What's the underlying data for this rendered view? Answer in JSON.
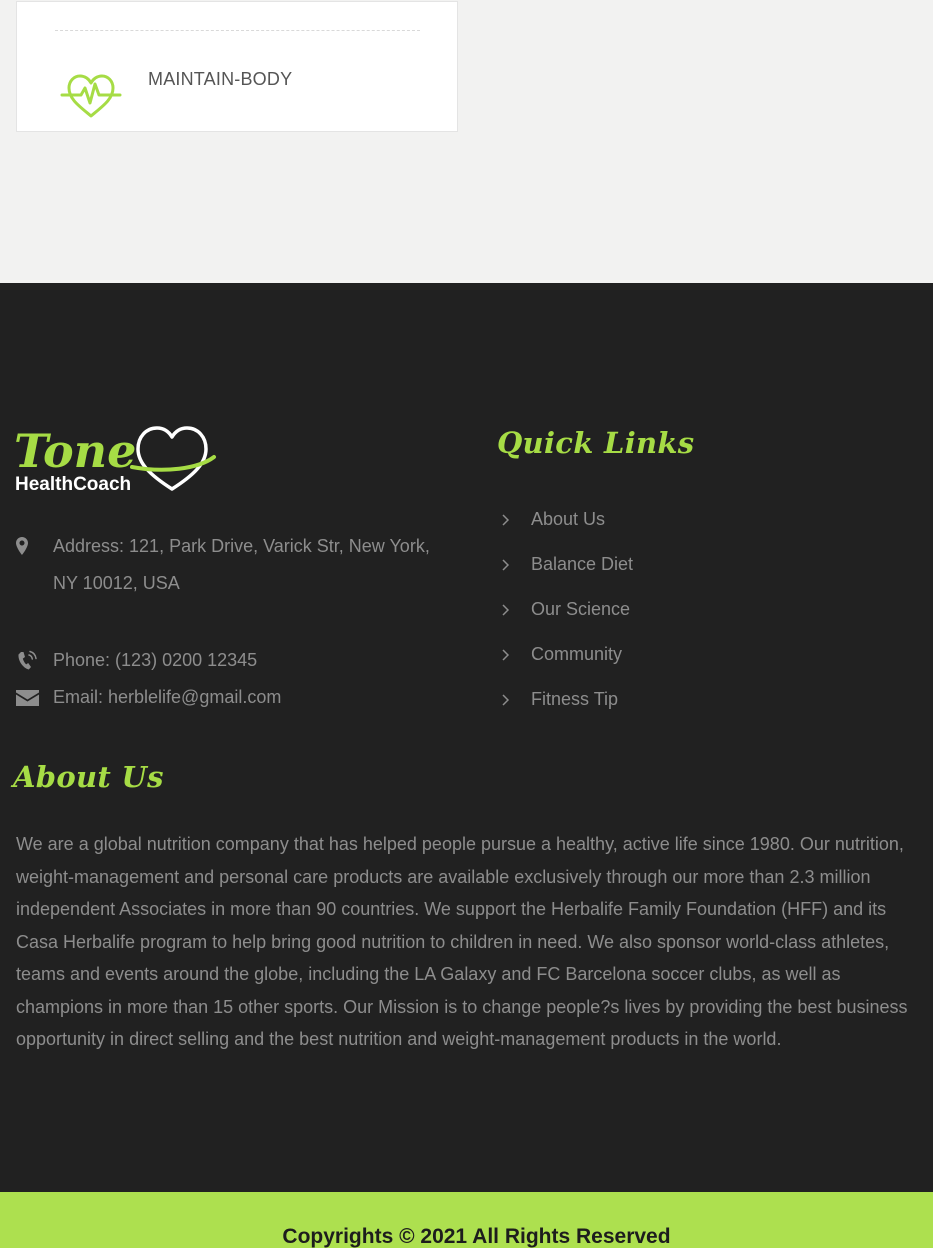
{
  "card": {
    "title": "MAINTAIN-BODY",
    "icon": "heartbeat-icon"
  },
  "footer": {
    "logo": {
      "word": "Tone",
      "sub": "HealthCoach"
    },
    "contact": {
      "address": "Address: 121, Park Drive, Varick Str, New York, NY 10012, USA",
      "phone": "Phone: (123) 0200 12345",
      "email": "Email: herblelife@gmail.com"
    },
    "quick_links": {
      "heading": "Quick Links",
      "items": [
        {
          "label": "About Us"
        },
        {
          "label": "Balance Diet"
        },
        {
          "label": "Our Science"
        },
        {
          "label": "Community"
        },
        {
          "label": "Fitness Tip"
        }
      ]
    },
    "about": {
      "heading": "About Us",
      "text": "We are a global nutrition company that has helped people pursue a healthy, active life since 1980. Our nutrition, weight-management and personal care products are available exclusively through our more than 2.3 million independent Associates in more than 90 countries. We support the Herbalife Family Foundation (HFF) and its Casa Herbalife program to help bring good nutrition to children in need. We also sponsor world-class athletes, teams and events around the globe, including the LA Galaxy and FC Barcelona soccer clubs, as well as champions in more than 15 other sports. Our Mission is to change people?s lives by providing the best business opportunity in direct selling and the best nutrition and weight-management products in the world."
    },
    "copyright": "Copyrights © 2021 All Rights Reserved"
  },
  "colors": {
    "accent": "#a6dc45",
    "footer_bg": "#212121",
    "copyright_bg": "#ade04f",
    "muted_text": "#8d8d8d"
  }
}
